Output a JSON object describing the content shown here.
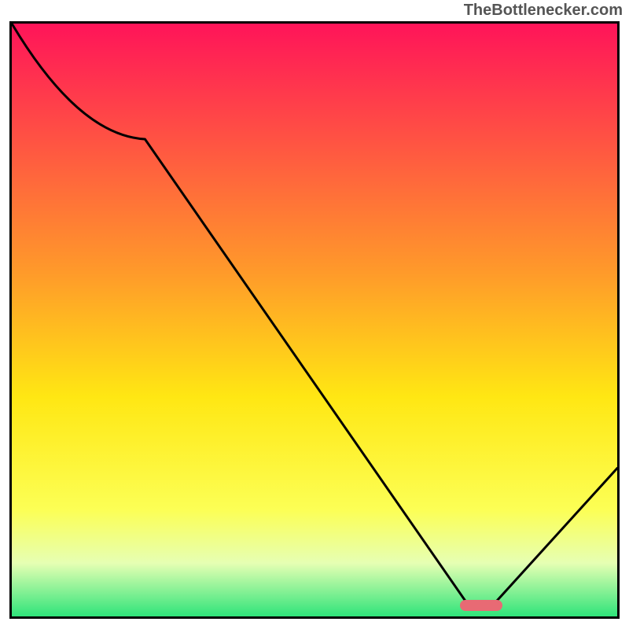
{
  "watermark": "TheBottlenecker.com",
  "chart_data": {
    "type": "line",
    "title": "",
    "xlabel": "",
    "ylabel": "",
    "xlim": [
      0,
      100
    ],
    "ylim": [
      0,
      100
    ],
    "x": [
      0,
      22,
      75,
      80,
      100
    ],
    "values": [
      100,
      80.5,
      2.5,
      2.5,
      25
    ],
    "marker": {
      "x_start": 74,
      "x_end": 81,
      "y": 1.8
    },
    "gradient_stops": [
      {
        "offset": 0,
        "color": "#ff1459"
      },
      {
        "offset": 0.42,
        "color": "#ff9a2a"
      },
      {
        "offset": 0.63,
        "color": "#ffe713"
      },
      {
        "offset": 0.82,
        "color": "#fcff55"
      },
      {
        "offset": 0.91,
        "color": "#e6ffb3"
      },
      {
        "offset": 1,
        "color": "#2fe47a"
      }
    ]
  }
}
